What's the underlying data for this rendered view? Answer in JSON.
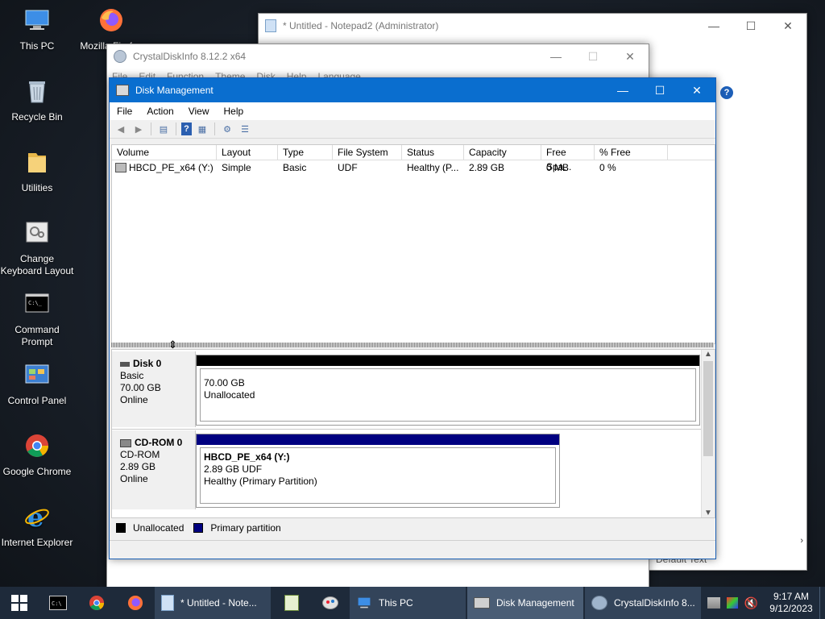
{
  "desktop": {
    "icons": [
      {
        "label": "This PC"
      },
      {
        "label": "Mozilla Firefox"
      },
      {
        "label": "Recycle Bin"
      },
      {
        "label": "Utilities"
      },
      {
        "label": "Change Keyboard Layout"
      },
      {
        "label": "Command Prompt"
      },
      {
        "label": "Control Panel"
      },
      {
        "label": "Google Chrome"
      },
      {
        "label": "Internet Explorer"
      }
    ]
  },
  "notepad": {
    "title": "* Untitled - Notepad2 (Administrator)",
    "bottom_text": "Default Text"
  },
  "crystal": {
    "title": "CrystalDiskInfo 8.12.2 x64",
    "menu": [
      "File",
      "Edit",
      "Function",
      "Theme",
      "Disk",
      "Help",
      "Language"
    ]
  },
  "diskmgmt": {
    "title": "Disk Management",
    "menu": [
      "File",
      "Action",
      "View",
      "Help"
    ],
    "columns": [
      "Volume",
      "Layout",
      "Type",
      "File System",
      "Status",
      "Capacity",
      "Free Spa...",
      "% Free"
    ],
    "rows": [
      [
        "HBCD_PE_x64 (Y:)",
        "Simple",
        "Basic",
        "UDF",
        "Healthy (P...",
        "2.89 GB",
        "0 MB",
        "0 %"
      ]
    ],
    "disks": [
      {
        "name": "Disk 0",
        "type": "Basic",
        "size": "70.00 GB",
        "status": "Online",
        "partition": {
          "title": "",
          "line1": "70.00 GB",
          "line2": "Unallocated"
        }
      },
      {
        "name": "CD-ROM 0",
        "type": "CD-ROM",
        "size": "2.89 GB",
        "status": "Online",
        "partition": {
          "title": "HBCD_PE_x64  (Y:)",
          "line1": "2.89 GB UDF",
          "line2": "Healthy (Primary Partition)"
        }
      }
    ],
    "legend": [
      "Unallocated",
      "Primary partition"
    ],
    "colors": {
      "unallocated": "#000000",
      "primary": "#000080"
    }
  },
  "taskbar": {
    "apps": [
      {
        "label": "* Untitled - Note..."
      },
      {
        "label": "This PC"
      },
      {
        "label": "Disk Management"
      },
      {
        "label": "CrystalDiskInfo 8..."
      }
    ],
    "time": "9:17 AM",
    "date": "9/12/2023"
  }
}
